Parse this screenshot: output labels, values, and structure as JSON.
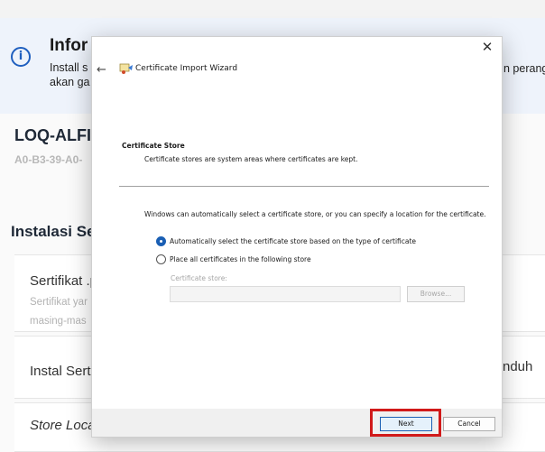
{
  "background": {
    "info": {
      "title": "Infor",
      "line1": "Install s",
      "line2": "akan ga",
      "right_text": "n perang"
    },
    "device": {
      "name": "LOQ-ALFI",
      "mac": "A0-B3-39-A0-"
    },
    "section_title": "Instalasi Se",
    "cards": {
      "cert_title": "Sertifikat .p",
      "cert_sub1": "Sertifikat yar",
      "cert_sub2": "masing-mas",
      "install_title": "Instal Serti",
      "install_right": "nduh",
      "store_location": "Store Locat"
    }
  },
  "dialog": {
    "title": "Certificate Import Wizard",
    "close_label": "✕",
    "back_label": "←",
    "step_title": "Certificate Store",
    "step_desc": "Certificate stores are system areas where certificates are kept.",
    "description": "Windows can automatically select a certificate store, or you can specify a location for the certificate.",
    "options": [
      {
        "label": "Automatically select the certificate store based on the type of certificate",
        "checked": true
      },
      {
        "label": "Place all certificates in the following store",
        "checked": false
      }
    ],
    "store_field_label": "Certificate store:",
    "store_field_value": "",
    "browse_label": "Browse...",
    "next_label": "Next",
    "cancel_label": "Cancel"
  },
  "colors": {
    "accent": "#1a5fb4",
    "highlight": "#d11a1a",
    "info_bar": "#eef3fb"
  }
}
